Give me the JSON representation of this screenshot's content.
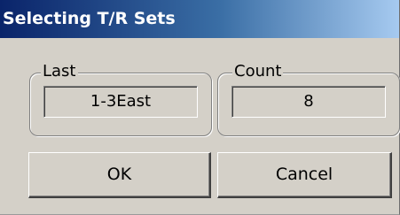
{
  "window": {
    "title": "Selecting T/R Sets"
  },
  "groups": {
    "last": {
      "label": "Last",
      "value": "1-3East"
    },
    "count": {
      "label": "Count",
      "value": "8"
    }
  },
  "buttons": {
    "ok_label": "OK",
    "cancel_label": "Cancel"
  },
  "colors": {
    "title_bar_start": "#0a246a",
    "title_bar_end": "#a6caf0",
    "dialog_background": "#d4d0c8"
  }
}
